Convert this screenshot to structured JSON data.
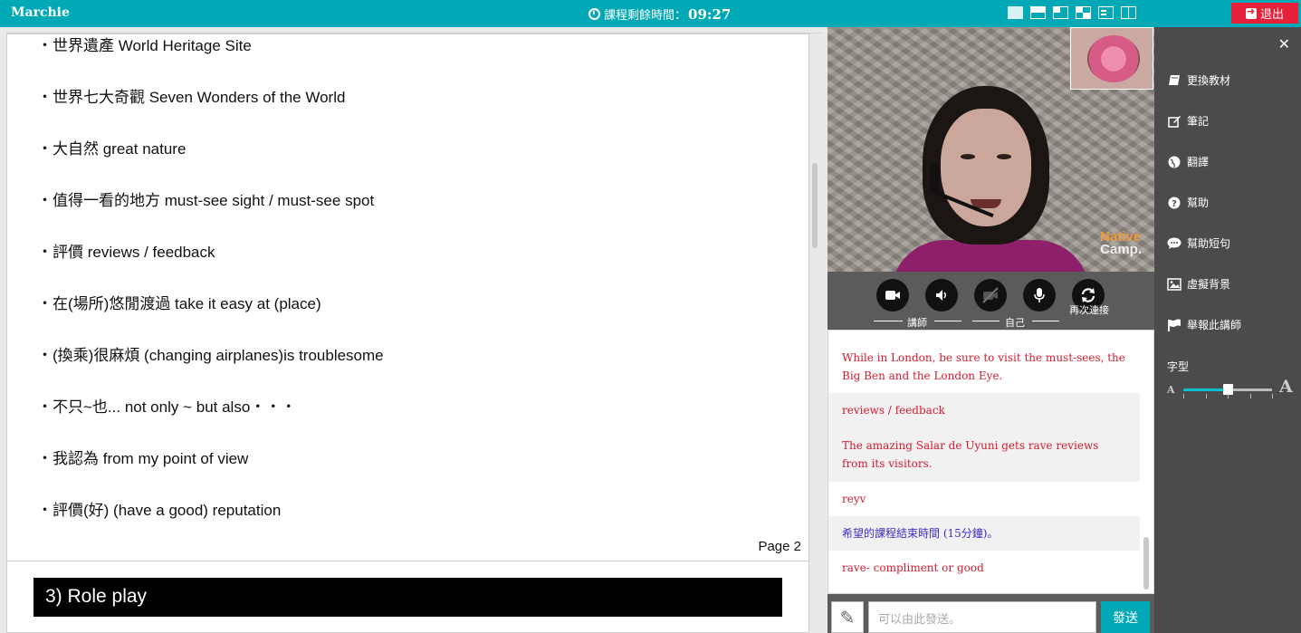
{
  "topbar": {
    "brand": "Marchie",
    "timer_label": "課程剩餘時間：",
    "timer_value": "09:27",
    "exit_label": "退出",
    "layout_icons": [
      "layout-video-full-icon",
      "layout-video-top-icon",
      "layout-video-left-top-icon",
      "layout-split-icon",
      "layout-text-icon",
      "layout-columns-icon"
    ]
  },
  "document": {
    "vocab": [
      "・世界遺產 World Heritage Site",
      "・世界七大奇觀 Seven Wonders of the World",
      "・大自然 great nature",
      "・值得一看的地方 must-see sight / must-see spot",
      "・評價 reviews / feedback",
      "・在(場所)悠閒渡過 take it easy at (place)",
      "・(換乘)很麻煩 (changing airplanes)is troublesome",
      "・不只~也... not only ~ but also・・・",
      "・我認為 from my point of view",
      "・評價(好) (have a good) reputation"
    ],
    "page_label": "Page 2",
    "section_heading": "3) Role play"
  },
  "video": {
    "watermark_line1": "Native",
    "watermark_line2": "Camp."
  },
  "controls": {
    "teacher_label": "講師",
    "self_label": "自己",
    "reconnect_label": "再次連接"
  },
  "chat": {
    "messages": [
      {
        "text": "While in London, be sure to visit the must-sees, the Big Ben and the London Eye.",
        "color": "red"
      },
      {
        "text": "reviews / feedback",
        "color": "red"
      },
      {
        "text": "The amazing Salar de Uyuni gets rave reviews from its visitors.",
        "color": "red"
      },
      {
        "text": "reyv",
        "color": "red"
      },
      {
        "text": "希望的課程結束時間 (15分鐘)。",
        "color": "blue"
      },
      {
        "text": "rave- compliment or good",
        "color": "red"
      }
    ],
    "input_placeholder": "可以由此發送。",
    "send_label": "發送"
  },
  "sidebar": {
    "items": [
      {
        "label": "更換教材",
        "icon": "book-icon"
      },
      {
        "label": "筆記",
        "icon": "edit-icon"
      },
      {
        "label": "翻譯",
        "icon": "globe-icon"
      },
      {
        "label": "幫助",
        "icon": "help-icon"
      },
      {
        "label": "幫助短句",
        "icon": "speech-bubble-icon"
      },
      {
        "label": "虛擬背景",
        "icon": "image-icon"
      },
      {
        "label": "舉報此講師",
        "icon": "flag-icon"
      }
    ],
    "font_label": "字型",
    "font_small": "A",
    "font_big": "A",
    "font_size_level": 0.5
  },
  "colors": {
    "accent": "#00a9b5",
    "exit": "#e8213a",
    "chat_red": "#d31b2f",
    "chat_blue": "#3b2ec9"
  }
}
